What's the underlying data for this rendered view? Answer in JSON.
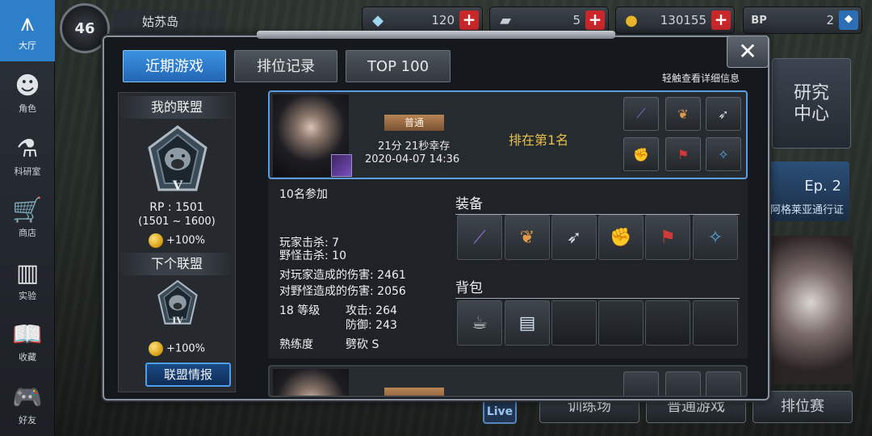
{
  "nav": {
    "items": [
      {
        "label": "大厅",
        "icon": "lobby-icon",
        "glyph": "⩚"
      },
      {
        "label": "角色",
        "icon": "character-icon",
        "glyph": "☻"
      },
      {
        "label": "科研室",
        "icon": "flask-icon",
        "glyph": "⚗"
      },
      {
        "label": "商店",
        "icon": "cart-icon",
        "glyph": "🛒"
      },
      {
        "label": "实验",
        "icon": "books-icon",
        "glyph": "▥"
      },
      {
        "label": "收藏",
        "icon": "book-icon",
        "glyph": "📖"
      },
      {
        "label": "好友",
        "icon": "gamepad-icon",
        "glyph": "🎮"
      }
    ]
  },
  "topbar": {
    "level": "46",
    "location": "姑苏岛",
    "resources": [
      {
        "icon": "crystal-icon",
        "glyph": "◆",
        "value": "120",
        "action": "+"
      },
      {
        "icon": "card-icon",
        "glyph": "▰",
        "value": "5",
        "action": "+"
      },
      {
        "icon": "coin-icon",
        "glyph": "●",
        "value": "130155",
        "action": "+"
      },
      {
        "icon": "bp-icon",
        "glyph": "BP",
        "value": "2",
        "action": "◆"
      }
    ]
  },
  "background": {
    "research_center": "研究\n中心",
    "ep_num": "Ep. 2",
    "ep_sub": "阿格莱亚通行证",
    "buttons": [
      "训练场",
      "普通游戏",
      "排位赛"
    ],
    "live": "Live"
  },
  "modal": {
    "tabs": [
      "近期游戏",
      "排位记录",
      "TOP 100"
    ],
    "close": "✕",
    "hint": "轻触查看详细信息"
  },
  "alliance": {
    "my_title": "我的联盟",
    "my_tier": "V",
    "rp": "RP : 1501",
    "rp_range": "(1501 ~ 1600)",
    "my_bonus": "+100%",
    "next_title": "下个联盟",
    "next_tier": "IV",
    "next_bonus": "+100%",
    "info_button": "联盟情报"
  },
  "match": {
    "mode": "普通",
    "survive": "21分 21秒幸存",
    "date": "2020-04-07 14:36",
    "rank": "排在第1名",
    "equip_icons": [
      "sword-icon",
      "wings-icon",
      "feather-icon",
      "gauntlet-icon",
      "boots-icon",
      "accessory-icon"
    ],
    "equip_glyphs": [
      "⟋",
      "❦",
      "➶",
      "✊",
      "⚑",
      "✧"
    ],
    "equip_colors": [
      "#8e6fe0",
      "#e09a4a",
      "#d9dee3",
      "#b84a3a",
      "#d03a3a",
      "#5aa8e0"
    ]
  },
  "details": {
    "participants": "10名参加",
    "player_kills": "玩家击杀: 7",
    "monster_kills": "野怪击杀: 10",
    "player_damage": "对玩家造成的伤害: 2461",
    "monster_damage": "对野怪造成的伤害: 2056",
    "level": "18 等级",
    "attack": "攻击: 264",
    "defense": "防御: 243",
    "proficiency_label": "熟练度",
    "proficiency_value": "劈砍 S",
    "equip_title": "装备",
    "bag_title": "背包",
    "bag_icons": [
      "teapot-icon",
      "bandage-icon"
    ],
    "bag_glyphs": [
      "☕",
      "▤"
    ]
  }
}
